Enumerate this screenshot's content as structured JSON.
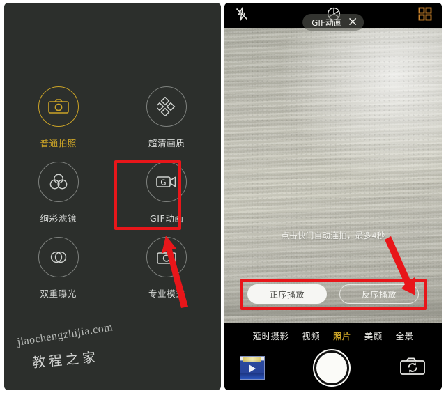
{
  "left_panel": {
    "name": "camera-mode-chooser",
    "background_color": "#2c2f2c",
    "accent_color": "#c9a227",
    "modes": [
      {
        "label": "普通拍照",
        "icon": "camera-icon",
        "selected": true
      },
      {
        "label": "超清画质",
        "icon": "four-diamonds-icon",
        "selected": false
      },
      {
        "label": "绚彩滤镜",
        "icon": "three-circles-filter-icon",
        "selected": false
      },
      {
        "label": "GIF动画",
        "icon": "gif-video-camera-icon",
        "selected": false
      },
      {
        "label": "双重曝光",
        "icon": "double-exposure-icon",
        "selected": false
      },
      {
        "label": "专业模式",
        "icon": "pro-camera-icon",
        "selected": false
      }
    ],
    "watermark": {
      "url": "jiaochengzhijia.com",
      "chinese": "教程之家"
    }
  },
  "right_panel": {
    "name": "camera-viewfinder",
    "topbar": {
      "flash_icon": "flash-off-icon",
      "shutter_mode_icon": "aperture-icon",
      "grid_icon": "grid-squares-icon",
      "grid_icon_color": "#c9822a"
    },
    "gif_pill": {
      "label": "GIF动画",
      "close_icon": "close-x-icon"
    },
    "hint": "点击快门自动连拍，最多4秒",
    "play_order_buttons": [
      {
        "label": "正序播放",
        "style": "filled",
        "selected": true
      },
      {
        "label": "反序播放",
        "style": "outlined",
        "selected": false
      }
    ],
    "mode_tabs": [
      {
        "label": "延时摄影",
        "selected": false
      },
      {
        "label": "视频",
        "selected": false
      },
      {
        "label": "照片",
        "selected": true
      },
      {
        "label": "美颜",
        "selected": false
      },
      {
        "label": "全景",
        "selected": false
      }
    ],
    "bottom_bar": {
      "gallery_thumbnail": "gallery-thumbnail",
      "shutter_button": "shutter-button",
      "switch_camera_icon": "switch-camera-icon"
    }
  },
  "annotations": {
    "highlight_color": "#e8161a",
    "boxes": [
      {
        "name": "gif-mode-highlight-box"
      },
      {
        "name": "play-order-highlight-box"
      }
    ],
    "arrows": [
      {
        "name": "arrow-pointing-gif-mode"
      },
      {
        "name": "arrow-pointing-play-order"
      }
    ]
  }
}
